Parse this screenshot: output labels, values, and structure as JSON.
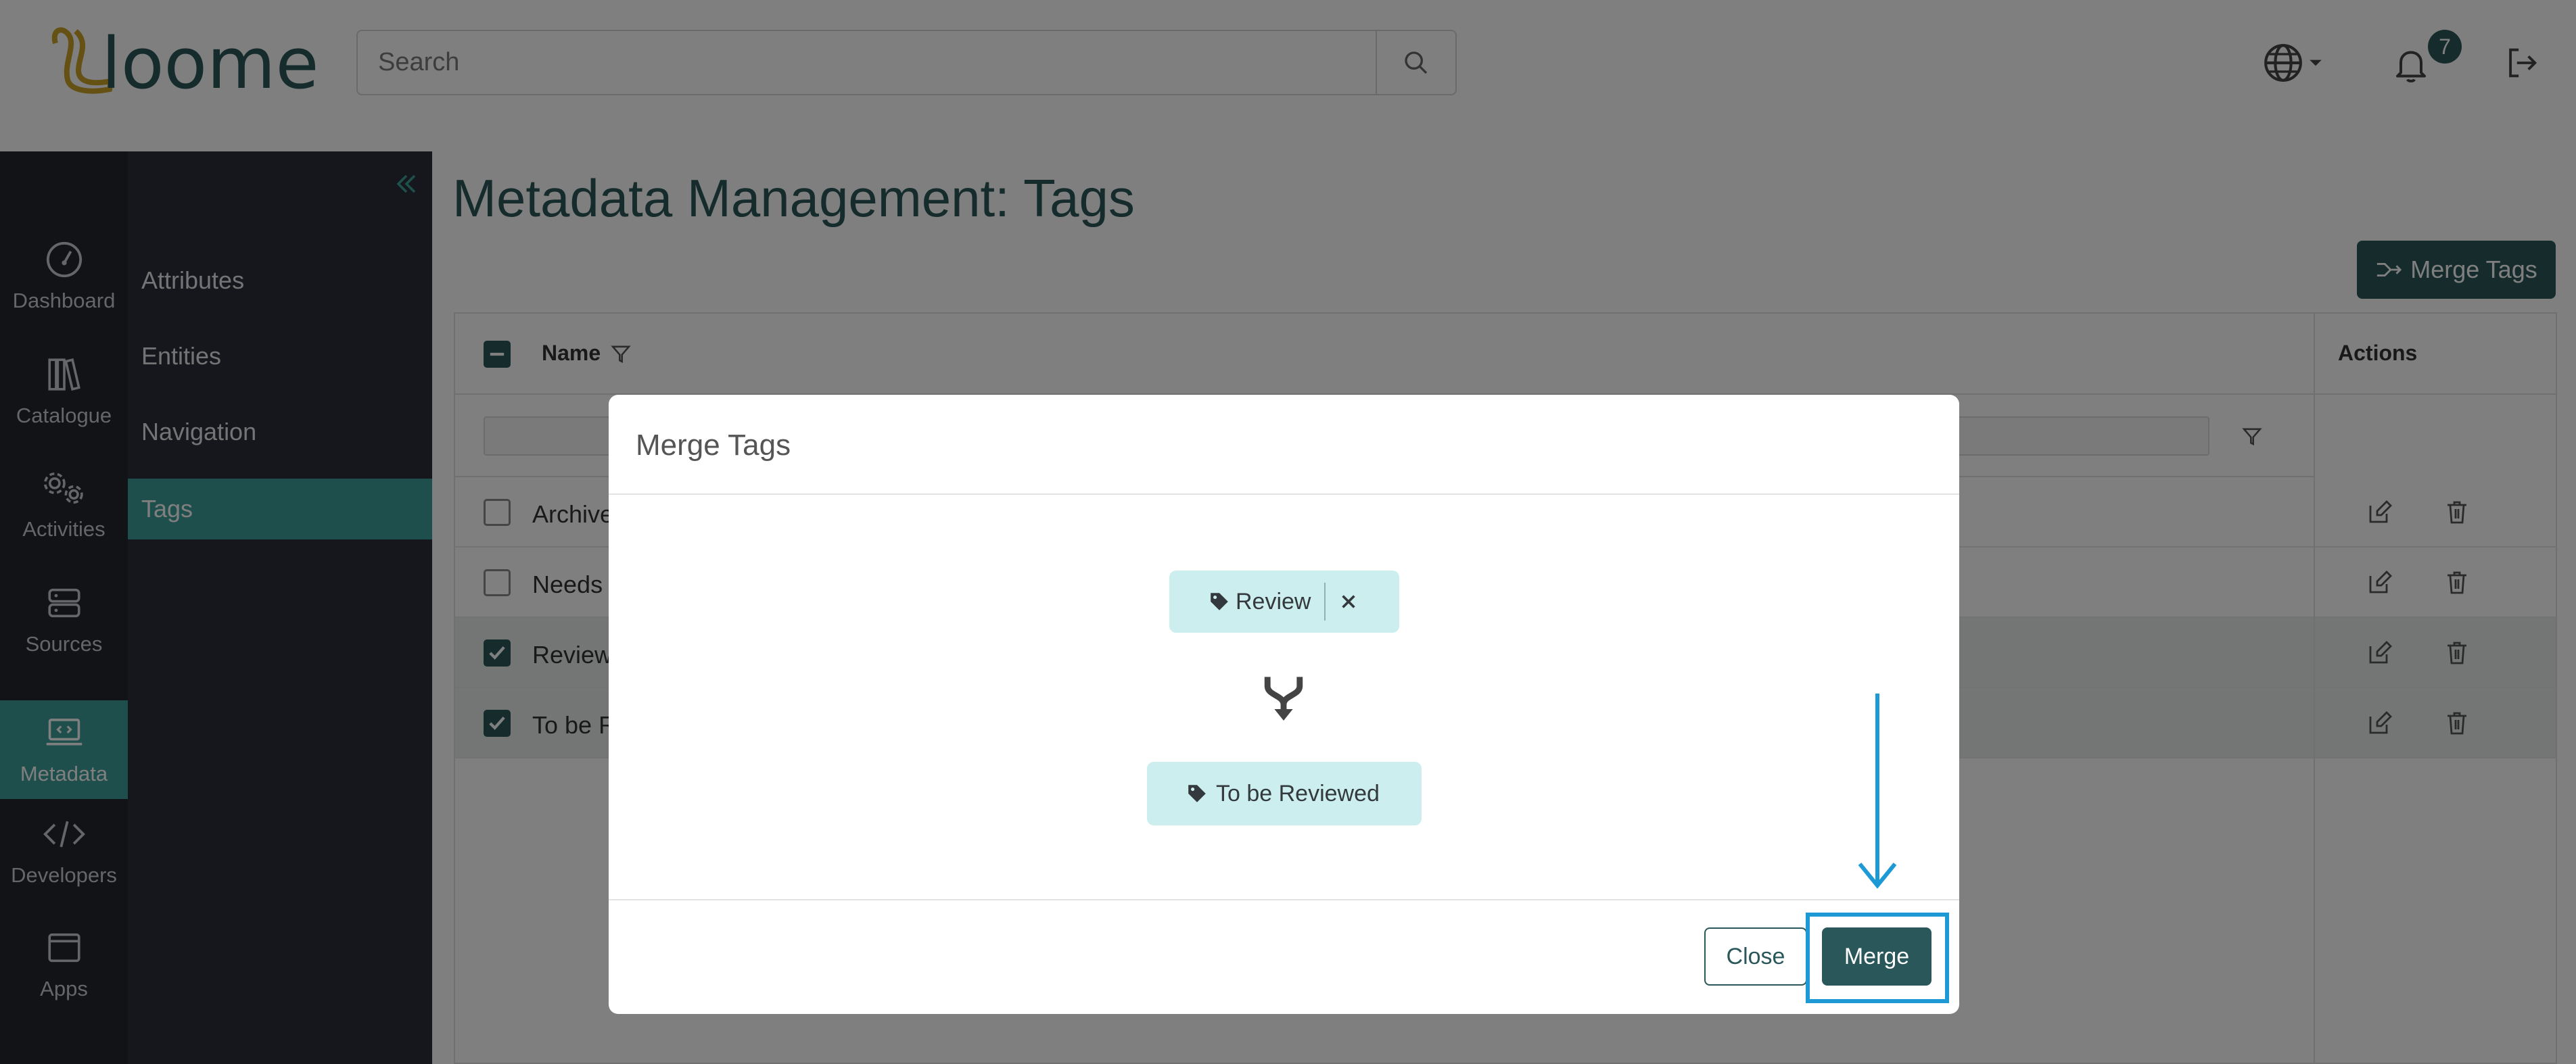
{
  "header": {
    "brand": "loome",
    "search_placeholder": "Search",
    "notifications_count": "7"
  },
  "rail": {
    "items": [
      {
        "label": "Dashboard",
        "icon": "gauge-icon"
      },
      {
        "label": "Catalogue",
        "icon": "books-icon"
      },
      {
        "label": "Activities",
        "icon": "gears-icon"
      },
      {
        "label": "Sources",
        "icon": "server-icon"
      },
      {
        "label": "Metadata",
        "icon": "laptop-code-icon"
      },
      {
        "label": "Developers",
        "icon": "code-icon"
      },
      {
        "label": "Apps",
        "icon": "window-icon"
      }
    ]
  },
  "subnav": {
    "items": [
      {
        "label": "Attributes"
      },
      {
        "label": "Entities"
      },
      {
        "label": "Navigation"
      },
      {
        "label": "Tags"
      }
    ]
  },
  "main": {
    "title": "Metadata Management: Tags",
    "merge_tags_label": "Merge Tags",
    "table": {
      "col_name": "Name",
      "col_actions": "Actions",
      "rows": [
        {
          "name": "Archive",
          "checked": false
        },
        {
          "name": "Needs R",
          "checked": false
        },
        {
          "name": "Review",
          "checked": true
        },
        {
          "name": "To be R",
          "checked": true
        }
      ]
    }
  },
  "modal": {
    "title": "Merge Tags",
    "source_tag": "Review",
    "target_tag": "To be Reviewed",
    "close_label": "Close",
    "merge_label": "Merge"
  },
  "colors": {
    "brand": "#2a5759",
    "accent": "#3f9f98",
    "chip": "#cdeeee",
    "annotation": "#1d9ad6"
  }
}
